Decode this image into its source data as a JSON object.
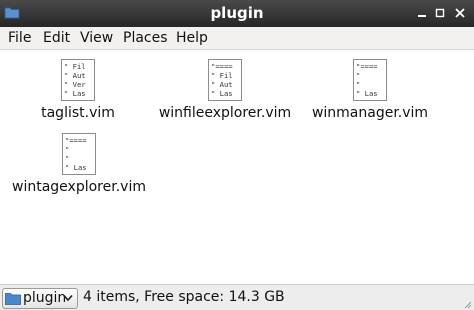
{
  "window": {
    "title": "plugin"
  },
  "menubar": {
    "items": [
      "File",
      "Edit",
      "View",
      "Places",
      "Help"
    ]
  },
  "files": [
    {
      "name": "taglist.vim",
      "preview": [
        "\" Fil",
        "\" Aut",
        "\" Ver",
        "\" Las"
      ]
    },
    {
      "name": "winfileexplorer.vim",
      "preview": [
        "\"====",
        "\" Fil",
        "\" Aut",
        "\" Las"
      ]
    },
    {
      "name": "winmanager.vim",
      "preview": [
        "\"====",
        "\"",
        "\"",
        "\" Las"
      ]
    },
    {
      "name": "wintagexplorer.vim",
      "preview": [
        "\"====",
        "\"",
        "\"",
        "\" Las"
      ]
    }
  ],
  "statusbar": {
    "location": "plugin",
    "info": "4 items, Free space: 14.3 GB"
  },
  "icons": {
    "app": "folder-icon",
    "location": "folder-icon",
    "dropdown": "chevron-down-icon"
  },
  "colors": {
    "titlebar": "#2f2f2f",
    "folder": "#4a86c8"
  }
}
